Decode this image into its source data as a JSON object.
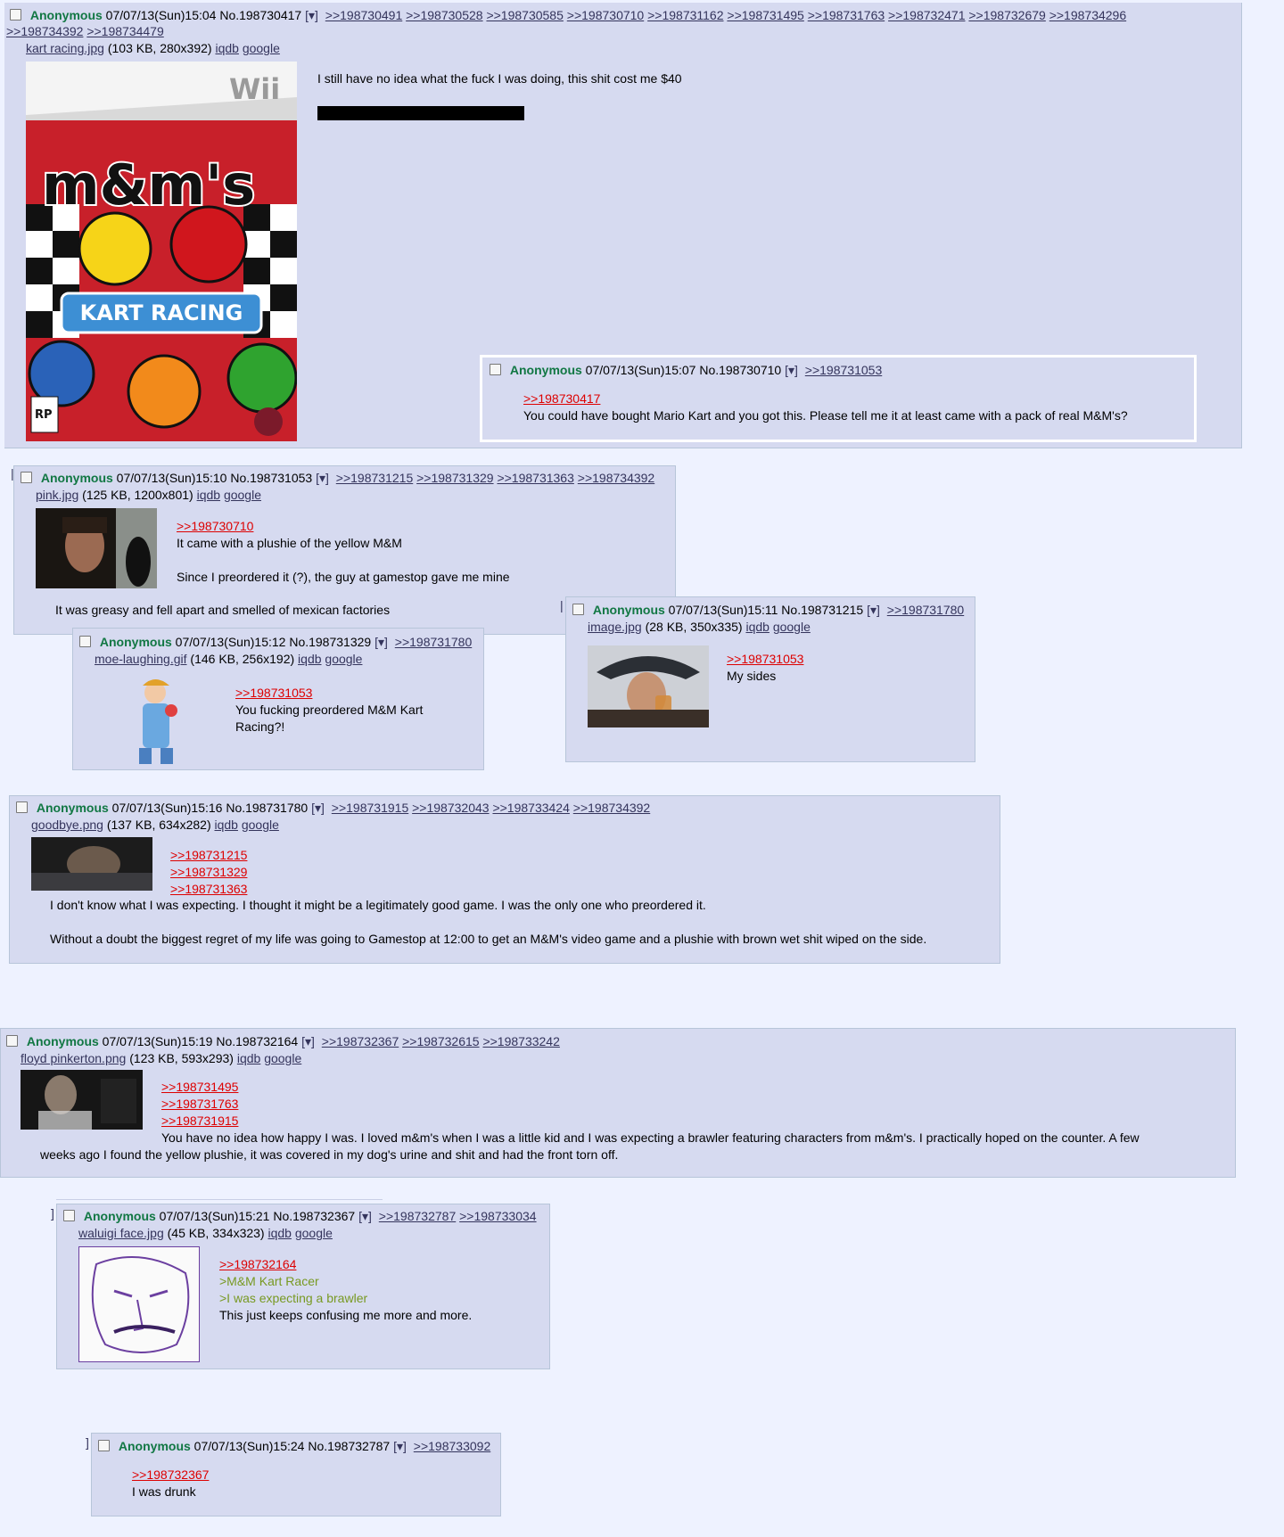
{
  "posts": {
    "op": {
      "name": "Anonymous",
      "datetime": "07/07/13(Sun)15:04",
      "number": "No.198730417",
      "menu": "[▾]",
      "replies_line1": [
        ">>198730491",
        ">>198730528",
        ">>198730585",
        ">>198730710",
        ">>198731162",
        ">>198731495",
        ">>198731763",
        ">>198732471",
        ">>198732679",
        ">>198734296"
      ],
      "replies_line2": [
        ">>198734392",
        ">>198734479"
      ],
      "file_name": "kart racing.jpg",
      "file_info": "(103 KB, 280x392)",
      "iqdb": "iqdb",
      "google": "google",
      "text": "I still have no idea what the fuck I was doing, this shit cost me $40",
      "image": {
        "wii": "Wii",
        "brand": "m&m's",
        "title": "KART RACING",
        "rating": "RP"
      }
    },
    "p198730710": {
      "name": "Anonymous",
      "datetime": "07/07/13(Sun)15:07",
      "number": "No.198730710",
      "menu": "[▾]",
      "replies": [
        ">>198731053"
      ],
      "quote": ">>198730417",
      "text": "You could have bought Mario Kart and you got this. Please tell me it at least came with a pack of real M&M's?"
    },
    "p198731053": {
      "name": "Anonymous",
      "datetime": "07/07/13(Sun)15:10",
      "number": "No.198731053",
      "menu": "[▾]",
      "replies": [
        ">>198731215",
        ">>198731329",
        ">>198731363",
        ">>198734392"
      ],
      "file_name": "pink.jpg",
      "file_info": "(125 KB, 1200x801)",
      "iqdb": "iqdb",
      "google": "google",
      "quote": ">>198730710",
      "line1": "It came with a plushie of the yellow M&M",
      "line2": "Since I preordered it (?), the guy at gamestop gave me mine",
      "line3": "It was greasy and fell apart and smelled of mexican factories"
    },
    "p198731329": {
      "name": "Anonymous",
      "datetime": "07/07/13(Sun)15:12",
      "number": "No.198731329",
      "menu": "[▾]",
      "replies": [
        ">>198731780"
      ],
      "file_name": "moe-laughing.gif",
      "file_info": "(146 KB, 256x192)",
      "iqdb": "iqdb",
      "google": "google",
      "quote": ">>198731053",
      "line1": "You fucking preordered M&M Kart",
      "line2": "Racing?!"
    },
    "p198731215": {
      "name": "Anonymous",
      "datetime": "07/07/13(Sun)15:11",
      "number": "No.198731215",
      "menu": "[▾]",
      "replies": [
        ">>198731780"
      ],
      "file_name": "image.jpg",
      "file_info": "(28 KB, 350x335)",
      "iqdb": "iqdb",
      "google": "google",
      "quote": ">>198731053",
      "text": "My sides"
    },
    "p198731780": {
      "name": "Anonymous",
      "datetime": "07/07/13(Sun)15:16",
      "number": "No.198731780",
      "menu": "[▾]",
      "replies": [
        ">>198731915",
        ">>198732043",
        ">>198733424",
        ">>198734392"
      ],
      "file_name": "goodbye.png",
      "file_info": "(137 KB, 634x282)",
      "iqdb": "iqdb",
      "google": "google",
      "quotes": [
        ">>198731215",
        ">>198731329",
        ">>198731363"
      ],
      "line1": "I don't know what I was expecting. I thought it might be a legitimately good game. I was the only one who preordered it.",
      "line2": "Without a doubt the biggest regret of my life was going to Gamestop at 12:00 to get an M&M's video game and a plushie with brown wet shit wiped on the side."
    },
    "p198732164": {
      "name": "Anonymous",
      "datetime": "07/07/13(Sun)15:19",
      "number": "No.198732164",
      "menu": "[▾]",
      "replies": [
        ">>198732367",
        ">>198732615",
        ">>198733242"
      ],
      "file_name": "floyd pinkerton.png",
      "file_info": "(123 KB, 593x293)",
      "iqdb": "iqdb",
      "google": "google",
      "quotes": [
        ">>198731495",
        ">>198731763",
        ">>198731915"
      ],
      "line1": "You have no idea how happy I was. I loved m&m's when I was a little kid and I was expecting a brawler featuring characters from m&m's. I practically hoped on the counter. A few",
      "line2": "weeks ago I found the yellow plushie, it was covered in my dog's urine and shit and had the front torn off."
    },
    "p198732367": {
      "name": "Anonymous",
      "datetime": "07/07/13(Sun)15:21",
      "number": "No.198732367",
      "menu": "[▾]",
      "replies": [
        ">>198732787",
        ">>198733034"
      ],
      "file_name": "waluigi face.jpg",
      "file_info": "(45 KB, 334x323)",
      "iqdb": "iqdb",
      "google": "google",
      "quote": ">>198732164",
      "green1": ">M&M Kart Racer",
      "green2": ">I was expecting a brawler",
      "text": "This just keeps confusing me more and more."
    },
    "p198732787": {
      "name": "Anonymous",
      "datetime": "07/07/13(Sun)15:24",
      "number": "No.198732787",
      "menu": "[▾]",
      "replies": [
        ">>198733092"
      ],
      "quote": ">>198732367",
      "text": "I was drunk"
    }
  },
  "colors": {
    "page_bg": "#eef2ff",
    "post_bg": "#d6daf0",
    "name": "#117743",
    "link": "#34345c",
    "quotelink": "#dd0000",
    "greentext": "#789922"
  }
}
